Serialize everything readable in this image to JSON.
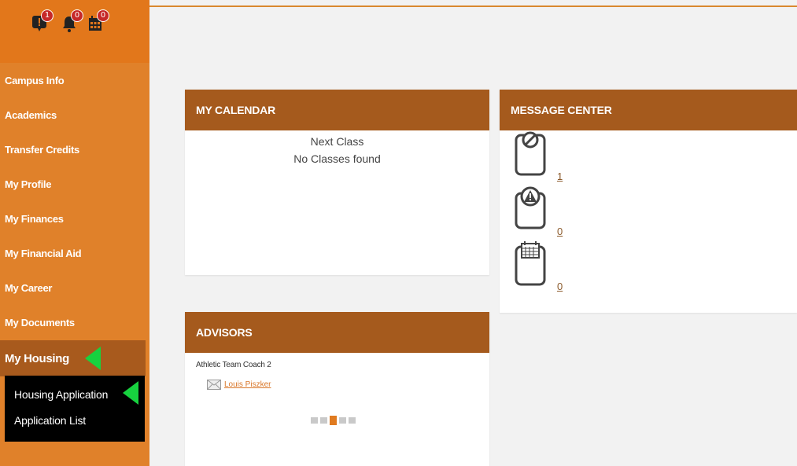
{
  "notifications": [
    {
      "icon": "alert-icon",
      "count": "1"
    },
    {
      "icon": "bell-icon",
      "count": "0"
    },
    {
      "icon": "calendar-icon",
      "count": "0"
    }
  ],
  "nav": {
    "items": [
      {
        "label": "Campus Info"
      },
      {
        "label": "Academics"
      },
      {
        "label": "Transfer Credits"
      },
      {
        "label": "My Profile"
      },
      {
        "label": "My Finances"
      },
      {
        "label": "My Financial Aid"
      },
      {
        "label": "My Career"
      },
      {
        "label": "My Documents"
      },
      {
        "label": "My Housing"
      }
    ],
    "submenu": [
      {
        "label": "Housing Application"
      },
      {
        "label": "Application List"
      }
    ]
  },
  "calendar": {
    "title": "MY CALENDAR",
    "next_class_label": "Next Class",
    "empty_text": "No Classes found"
  },
  "message_center": {
    "title": "MESSAGE CENTER",
    "rows": [
      {
        "icon": "no-entry-icon",
        "count": "1"
      },
      {
        "icon": "warning-icon",
        "count": "0"
      },
      {
        "icon": "calendar-icon",
        "count": "0"
      }
    ]
  },
  "advisors": {
    "title": "ADVISORS",
    "role": "Athletic Team Coach 2",
    "name": "Louis Piszker"
  },
  "colors": {
    "sidebar": "#e0812a",
    "panel_header": "#a55a1d",
    "highlight_arrow": "#17d23f"
  }
}
